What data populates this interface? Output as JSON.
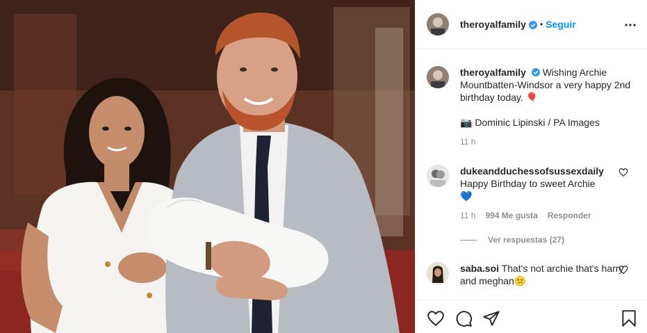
{
  "post": {
    "username": "theroyalfamily",
    "follow_label": "Seguir",
    "separator": "•",
    "verified": true,
    "accent_color": "#0095f6"
  },
  "caption": {
    "username": "theroyalfamily",
    "text": "Wishing Archie Mountbatten-Windsor a very happy 2nd birthday today.",
    "emoji_balloon": "🎈",
    "credit": "Dominic Lipinski / PA Images",
    "camera_emoji": "📷",
    "time": "11 h"
  },
  "comments": [
    {
      "username": "dukeandduchessofsussexdaily",
      "text": "Happy Birthday to sweet Archie",
      "emoji": "💙",
      "time": "11 h",
      "likes": "994 Me gusta",
      "reply_label": "Responder"
    },
    {
      "username": "saba.soi",
      "text": "That's not archie that's harry and meghan",
      "emoji": "😕"
    }
  ],
  "replies": {
    "label": "Ver respuestas (27)"
  },
  "actions": [
    "heart-icon",
    "comment-icon",
    "share-icon",
    "save-icon"
  ]
}
